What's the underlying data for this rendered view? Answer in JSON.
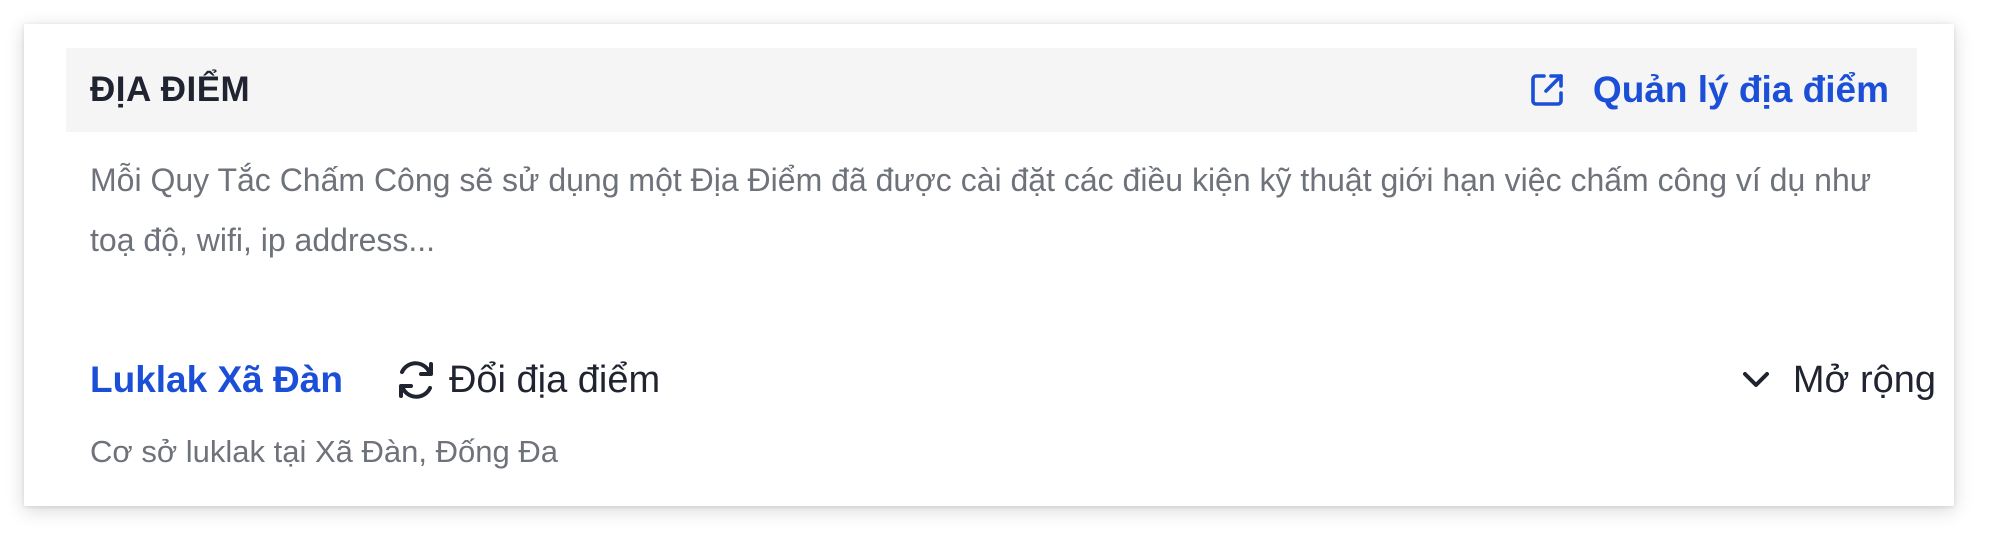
{
  "header": {
    "title": "ĐỊA ĐIỂM",
    "manage_label": "Quản lý địa điểm",
    "manage_icon": "external-link-icon"
  },
  "description": "Mỗi Quy Tắc Chấm Công sẽ sử dụng một Địa Điểm đã được cài đặt các điều kiện kỹ thuật giới hạn việc chấm công ví dụ như toạ độ, wifi, ip address...",
  "location": {
    "name": "Luklak Xã Đàn",
    "change_label": "Đổi địa điểm",
    "change_icon": "refresh-icon",
    "expand_label": "Mở rộng",
    "expand_icon": "chevron-down-icon",
    "detail": "Cơ sở luklak tại Xã Đàn, Đống Đa"
  },
  "colors": {
    "accent": "#1b4fd8",
    "text": "#1f2430",
    "muted": "#6e727a",
    "header_bg": "#f5f5f6"
  }
}
